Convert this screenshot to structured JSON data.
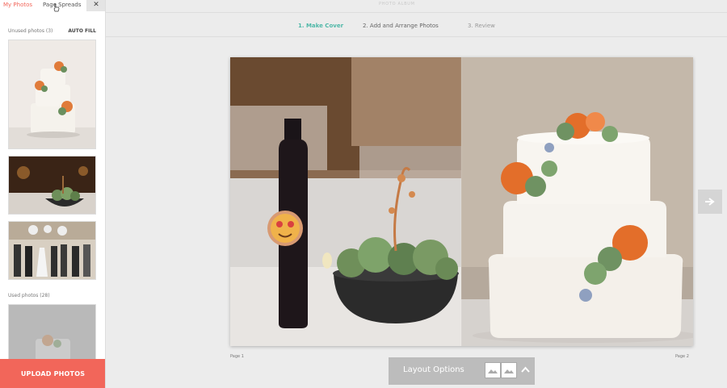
{
  "sidebar": {
    "tabs": [
      {
        "label": "My Photos",
        "active": true
      },
      {
        "label": "Page Spreads",
        "active": false
      }
    ],
    "close_label": "✕",
    "unused_label": "Unused photos (3)",
    "autofill_label": "AUTO FILL",
    "used_label": "Used photos (28)",
    "upload_label": "UPLOAD PHOTOS",
    "accent_color": "#f2665a"
  },
  "header": {
    "app_title": "PHOTO ALBUM",
    "steps": [
      {
        "label": "1. Make Cover",
        "active": true
      },
      {
        "label": "2. Add and Arrange Photos",
        "active": false
      },
      {
        "label": "3. Review",
        "active": false
      }
    ],
    "active_color": "#4fb8a8"
  },
  "spread": {
    "page_left": "Page 1",
    "page_right": "Page 2"
  },
  "controls": {
    "next_icon": "arrow-right-icon",
    "layout_options_label": "Layout Options"
  }
}
